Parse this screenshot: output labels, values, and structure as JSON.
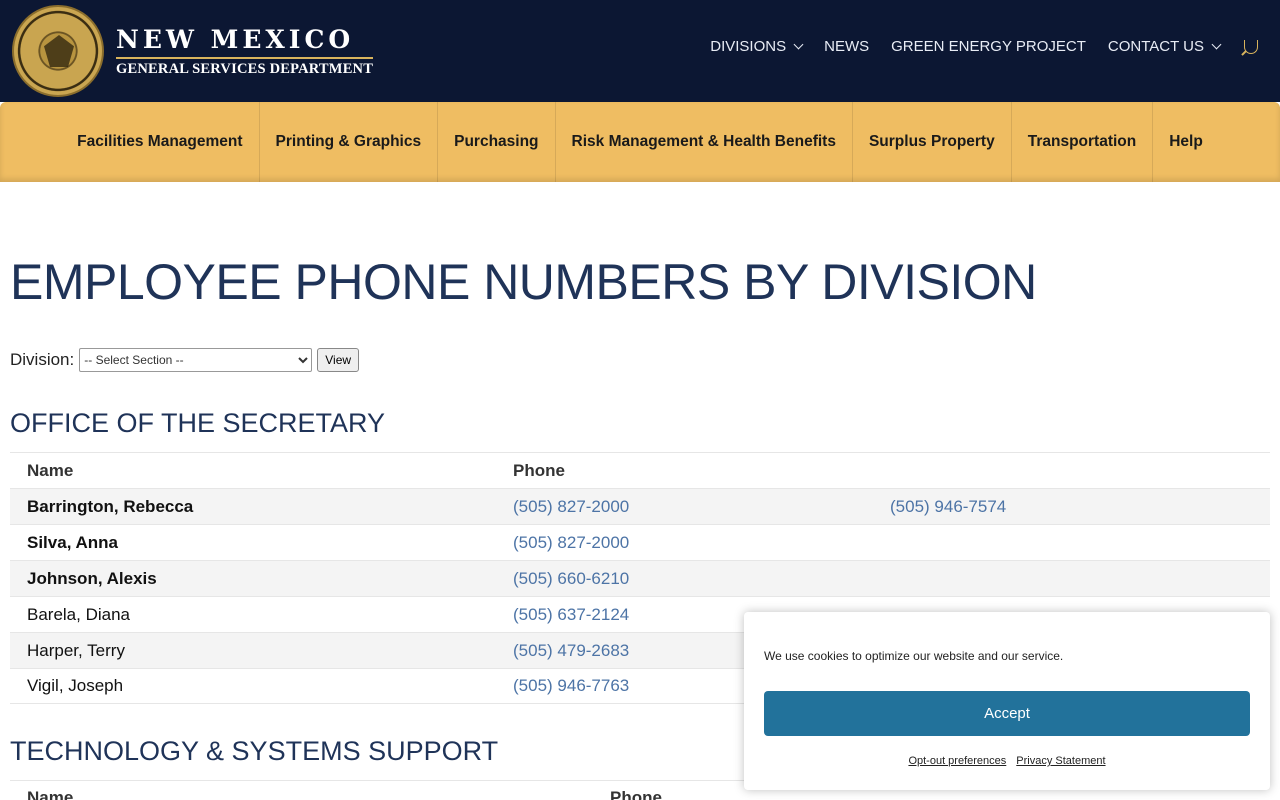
{
  "header": {
    "logo_title": "NEW MEXICO",
    "logo_subtitle": "GENERAL SERVICES DEPARTMENT",
    "nav": [
      {
        "label": "DIVISIONS"
      },
      {
        "label": "NEWS"
      },
      {
        "label": "GREEN ENERGY PROJECT"
      },
      {
        "label": "CONTACT US"
      }
    ]
  },
  "division_bar": [
    "Facilities Management",
    "Printing & Graphics",
    "Purchasing",
    "Risk Management & Health Benefits",
    "Surplus Property",
    "Transportation",
    "Help"
  ],
  "page": {
    "title": "EMPLOYEE PHONE NUMBERS BY DIVISION",
    "filter_label": "Division:",
    "filter_selected": "-- Select Section --",
    "view_label": "View"
  },
  "sections": [
    {
      "title": "OFFICE OF THE SECRETARY",
      "col_name": "Name",
      "col_phone": "Phone",
      "rows": [
        {
          "name": "Barrington, Rebecca",
          "phone": "(505) 827-2000",
          "phone2": "(505) 946-7574"
        },
        {
          "name": "Silva, Anna",
          "phone": "(505) 827-2000",
          "phone2": ""
        },
        {
          "name": "Johnson, Alexis",
          "phone": "(505) 660-6210",
          "phone2": ""
        },
        {
          "name": "Barela, Diana",
          "phone": "(505) 637-2124",
          "phone2": ""
        },
        {
          "name": "Harper, Terry",
          "phone": "(505) 479-2683",
          "phone2": ""
        },
        {
          "name": "Vigil, Joseph",
          "phone": "(505) 946-7763",
          "phone2": ""
        }
      ]
    },
    {
      "title": "TECHNOLOGY & SYSTEMS SUPPORT",
      "col_name": "Name",
      "col_phone": "Phone"
    }
  ],
  "cookie": {
    "message": "We use cookies to optimize our website and our service.",
    "accept": "Accept",
    "opt_out": "Opt-out preferences",
    "privacy": "Privacy Statement"
  },
  "colors": {
    "header_bg": "#0c1733",
    "division_bar_bg": "#efbd62",
    "title_color": "#1f3358",
    "link_color": "#4d74a6",
    "accept_bg": "#22729b"
  }
}
